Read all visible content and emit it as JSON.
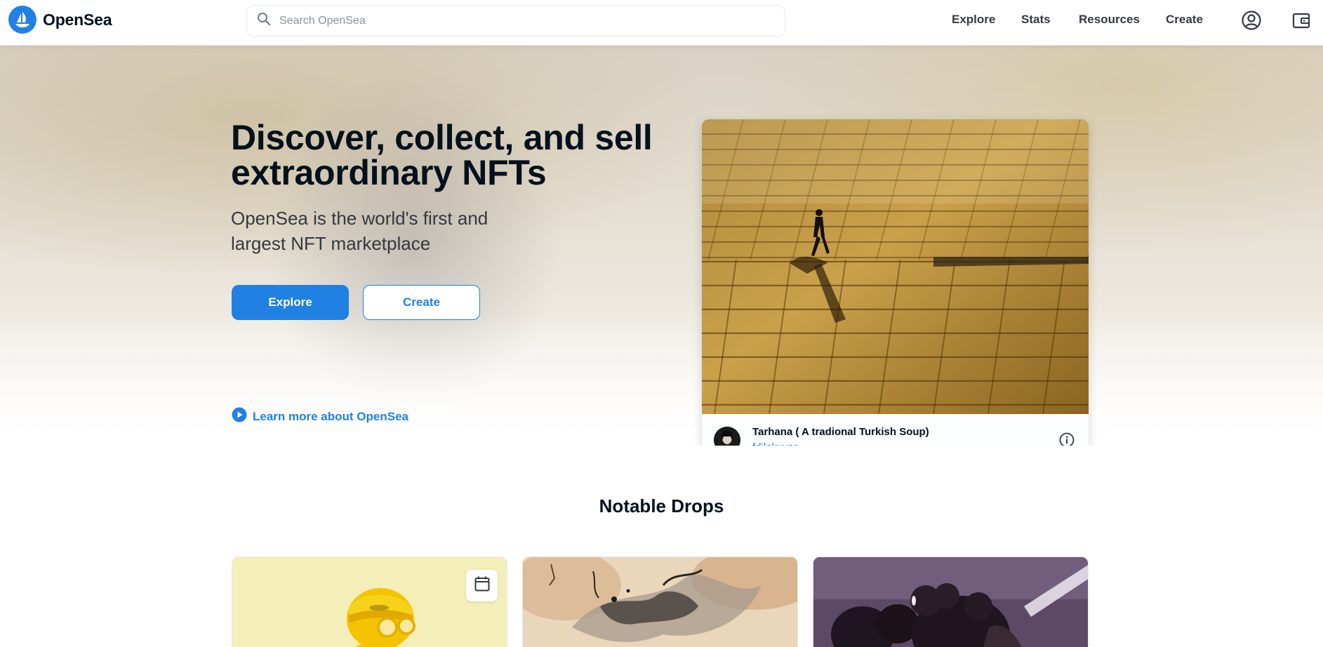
{
  "navbar": {
    "brand": "OpenSea",
    "search_placeholder": "Search OpenSea",
    "links": [
      "Explore",
      "Stats",
      "Resources",
      "Create"
    ]
  },
  "hero": {
    "title_line1": "Discover, collect, and sell",
    "title_line2": "extraordinary NFTs",
    "subtitle_line1": "OpenSea is the world's first and",
    "subtitle_line2": "largest NFT marketplace",
    "explore_label": "Explore",
    "create_label": "Create",
    "learn_more": "Learn more about OpenSea"
  },
  "featured": {
    "title": "Tarhana ( A tradional Turkish Soup)",
    "creator": "fdilekuyar"
  },
  "notable_drops": {
    "title": "Notable Drops"
  },
  "colors": {
    "brand_blue": "#2081e2",
    "text_dark": "#04111d"
  },
  "icons": [
    "opensea-logo-icon",
    "search-icon",
    "account-icon",
    "wallet-icon",
    "play-circle-icon",
    "info-icon",
    "calendar-icon"
  ]
}
